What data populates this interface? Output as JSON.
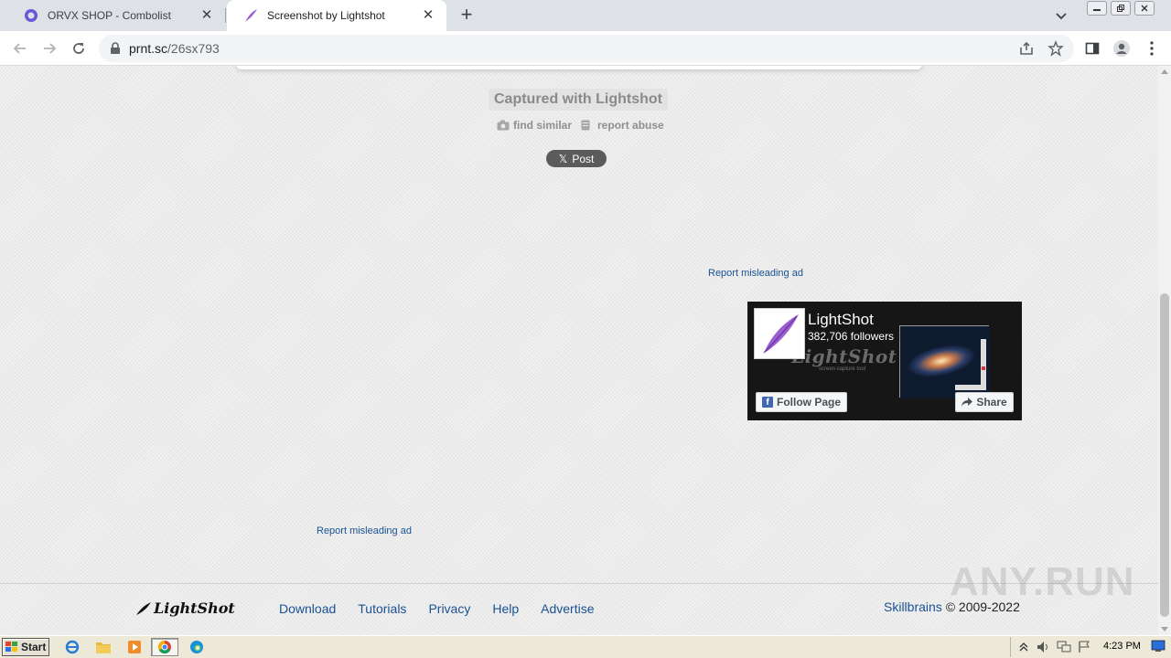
{
  "browser": {
    "tabs": [
      {
        "title": "ORVX SHOP - Combolist",
        "active": false,
        "favicon": "globe-icon"
      },
      {
        "title": "Screenshot by Lightshot",
        "active": true,
        "favicon": "lightshot-feather-icon"
      }
    ],
    "url_host": "prnt.sc",
    "url_path": "/26sx793",
    "close_glyph": "✕",
    "newtab_glyph": "+"
  },
  "page": {
    "captured_label": "Captured with Lightshot",
    "find_similar": "find similar",
    "report_abuse": "report abuse",
    "x_post": "Post",
    "x_glyph": "𝕏",
    "report_ad_1": "Report misleading ad",
    "report_ad_2": "Report misleading ad"
  },
  "fb_widget": {
    "page_name": "LightShot",
    "followers": "382,706 followers",
    "cover_title": "LightShot",
    "cover_subtitle": "screen capture tool",
    "follow_label": "Follow Page",
    "share_label": "Share"
  },
  "footer": {
    "logo_text": "LightShot",
    "nav": [
      "Download",
      "Tutorials",
      "Privacy",
      "Help",
      "Advertise"
    ],
    "company": "Skillbrains",
    "copyright": "© 2009-2022",
    "watermark": "ANY.RUN"
  },
  "taskbar": {
    "start_label": "Start",
    "clock": "4:23 PM"
  },
  "colors": {
    "link": "#1a5294",
    "fb_blue": "#4267b2"
  }
}
